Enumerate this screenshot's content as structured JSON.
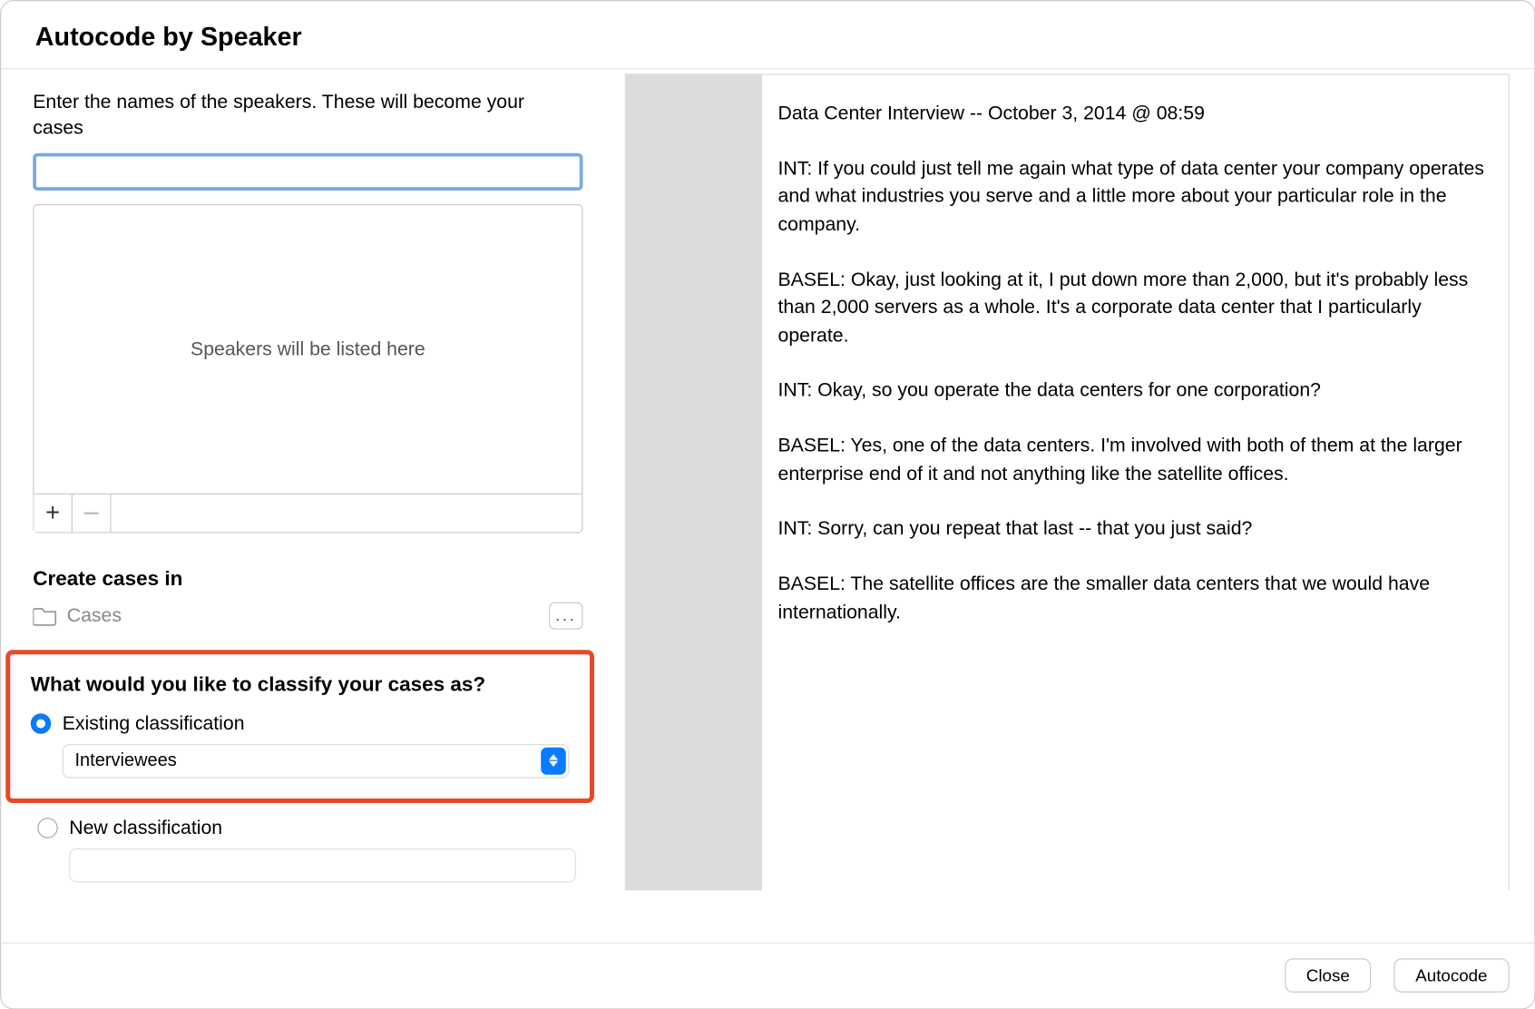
{
  "dialog": {
    "title": "Autocode by Speaker",
    "instruction": "Enter the names of the speakers. These will become your cases",
    "speaker_input_value": "",
    "speaker_list_placeholder": "Speakers will be listed here",
    "toolbar": {
      "add_label": "+",
      "remove_label": "−"
    },
    "create_cases_heading": "Create cases in",
    "cases_folder_label": "Cases",
    "more_label": "...",
    "classify_heading": "What would you like to classify your cases as?",
    "existing_radio_label": "Existing classification",
    "existing_select_value": "Interviewees",
    "new_radio_label": "New classification",
    "footer": {
      "close": "Close",
      "autocode": "Autocode"
    }
  },
  "preview": {
    "header": "Data Center Interview -- October 3, 2014 @ 08:59",
    "paragraphs": [
      "INT:  If you could just tell me again what type of data center your company operates and what industries you serve and a little more about your particular role in the company.",
      "BASEL:  Okay, just looking at it, I put down more than 2,000, but it's probably less than 2,000 servers as a whole. It's a corporate data center that I particularly operate.",
      "INT:  Okay, so you operate the data centers for one corporation?",
      "BASEL:  Yes, one of the data centers. I'm involved with both of them at the larger enterprise end of it and not anything like the satellite offices.",
      "INT:  Sorry, can you repeat that last -- that you just said?",
      "BASEL:  The satellite offices are the smaller data centers that we would have internationally."
    ]
  }
}
